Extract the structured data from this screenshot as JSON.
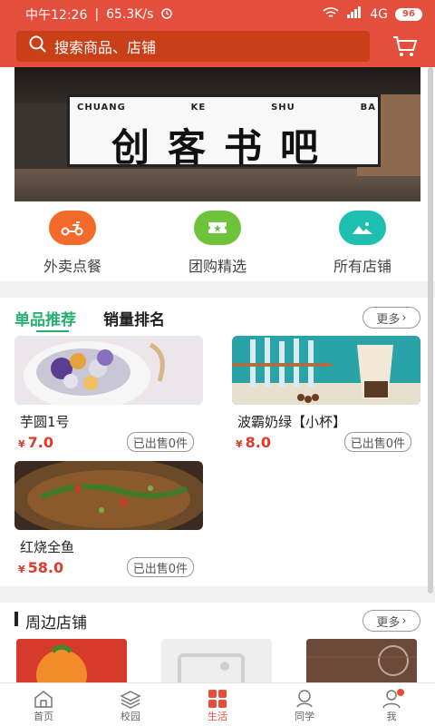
{
  "status": {
    "time": "中午12:26",
    "speed": "65.3K/s",
    "network": "4G",
    "battery": "96"
  },
  "search": {
    "placeholder": "搜索商品、店铺"
  },
  "banner": {
    "pinyin": [
      "CHUANG",
      "KE",
      "SHU",
      "BA"
    ],
    "title": "创客书吧"
  },
  "quick": [
    {
      "label": "外卖点餐",
      "color": "#f26b2a",
      "icon": "scooter-icon"
    },
    {
      "label": "团购精选",
      "color": "#6fc33b",
      "icon": "ticket-icon"
    },
    {
      "label": "所有店铺",
      "color": "#1fbfb0",
      "icon": "mountain-image-icon"
    }
  ],
  "products_section": {
    "tabs": [
      "单品推荐",
      "销量排名"
    ],
    "more": "更多"
  },
  "products": [
    {
      "name": "芋圆1号",
      "currency": "¥",
      "price": "7.0",
      "sold": "已出售0件"
    },
    {
      "name": "波霸奶绿【小杯】",
      "currency": "¥",
      "price": "8.0",
      "sold": "已出售0件"
    },
    {
      "name": "红烧全鱼",
      "currency": "¥",
      "price": "58.0",
      "sold": "已出售0件"
    }
  ],
  "shops_section": {
    "title": "周边店铺",
    "more": "更多"
  },
  "tabbar": [
    {
      "label": "首页",
      "icon": "home-icon"
    },
    {
      "label": "校园",
      "icon": "campus-icon"
    },
    {
      "label": "生活",
      "icon": "grid-icon",
      "active": true
    },
    {
      "label": "同学",
      "icon": "classmates-icon"
    },
    {
      "label": "我",
      "icon": "user-icon"
    }
  ],
  "colors": {
    "brand": "#e44e3c",
    "accent_green": "#24b26b",
    "price": "#e03a2c"
  }
}
